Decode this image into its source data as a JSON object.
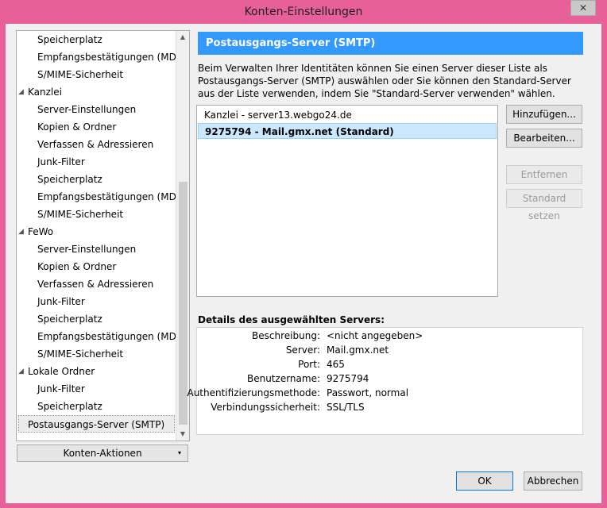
{
  "window": {
    "title": "Konten-Einstellungen",
    "close_symbol": "✕"
  },
  "tree": {
    "items": [
      {
        "label": "Speicherplatz",
        "level": 1
      },
      {
        "label": "Empfangsbestätigungen (MDN)",
        "level": 1
      },
      {
        "label": "S/MIME-Sicherheit",
        "level": 1
      },
      {
        "label": "Kanzlei",
        "level": 0
      },
      {
        "label": "Server-Einstellungen",
        "level": 1
      },
      {
        "label": "Kopien & Ordner",
        "level": 1
      },
      {
        "label": "Verfassen & Adressieren",
        "level": 1
      },
      {
        "label": "Junk-Filter",
        "level": 1
      },
      {
        "label": "Speicherplatz",
        "level": 1
      },
      {
        "label": "Empfangsbestätigungen (MDN)",
        "level": 1
      },
      {
        "label": "S/MIME-Sicherheit",
        "level": 1
      },
      {
        "label": "FeWo",
        "level": 0
      },
      {
        "label": "Server-Einstellungen",
        "level": 1
      },
      {
        "label": "Kopien & Ordner",
        "level": 1
      },
      {
        "label": "Verfassen & Adressieren",
        "level": 1
      },
      {
        "label": "Junk-Filter",
        "level": 1
      },
      {
        "label": "Speicherplatz",
        "level": 1
      },
      {
        "label": "Empfangsbestätigungen (MDN)",
        "level": 1
      },
      {
        "label": "S/MIME-Sicherheit",
        "level": 1
      },
      {
        "label": "Lokale Ordner",
        "level": 0
      },
      {
        "label": "Junk-Filter",
        "level": 1
      },
      {
        "label": "Speicherplatz",
        "level": 1
      },
      {
        "label": "Postausgangs-Server (SMTP)",
        "level": 0,
        "selected": true
      }
    ],
    "expander_symbol": "◢"
  },
  "account_actions": {
    "label": "Konten-Aktionen",
    "arrow": "▾"
  },
  "main": {
    "header": "Postausgangs-Server (SMTP)",
    "description": "Beim Verwalten Ihrer Identitäten können Sie einen Server dieser Liste als Postausgangs-Server (SMTP) auswählen oder Sie können den Standard-Server aus der Liste verwenden, indem Sie \"Standard-Server verwenden\" wählen.",
    "servers": [
      {
        "label": "Kanzlei - server13.webgo24.de",
        "selected": false
      },
      {
        "label": "9275794 - Mail.gmx.net (Standard)",
        "selected": true
      }
    ],
    "buttons": {
      "add": "Hinzufügen...",
      "edit": "Bearbeiten...",
      "remove": "Entfernen",
      "set_default": "Standard setzen"
    },
    "details_title": "Details des ausgewählten Servers:",
    "details": [
      {
        "label": "Beschreibung:",
        "value": "<nicht angegeben>"
      },
      {
        "label": "Server:",
        "value": "Mail.gmx.net"
      },
      {
        "label": "Port:",
        "value": "465"
      },
      {
        "label": "Benutzername:",
        "value": "9275794"
      },
      {
        "label": "Authentifizierungsmethode:",
        "value": "Passwort, normal"
      },
      {
        "label": "Verbindungssicherheit:",
        "value": "SSL/TLS"
      }
    ]
  },
  "footer": {
    "ok": "OK",
    "cancel": "Abbrechen"
  },
  "colors": {
    "title_bar": "#e8609a",
    "header_blue": "#3399ff",
    "selection": "#cce8ff"
  }
}
